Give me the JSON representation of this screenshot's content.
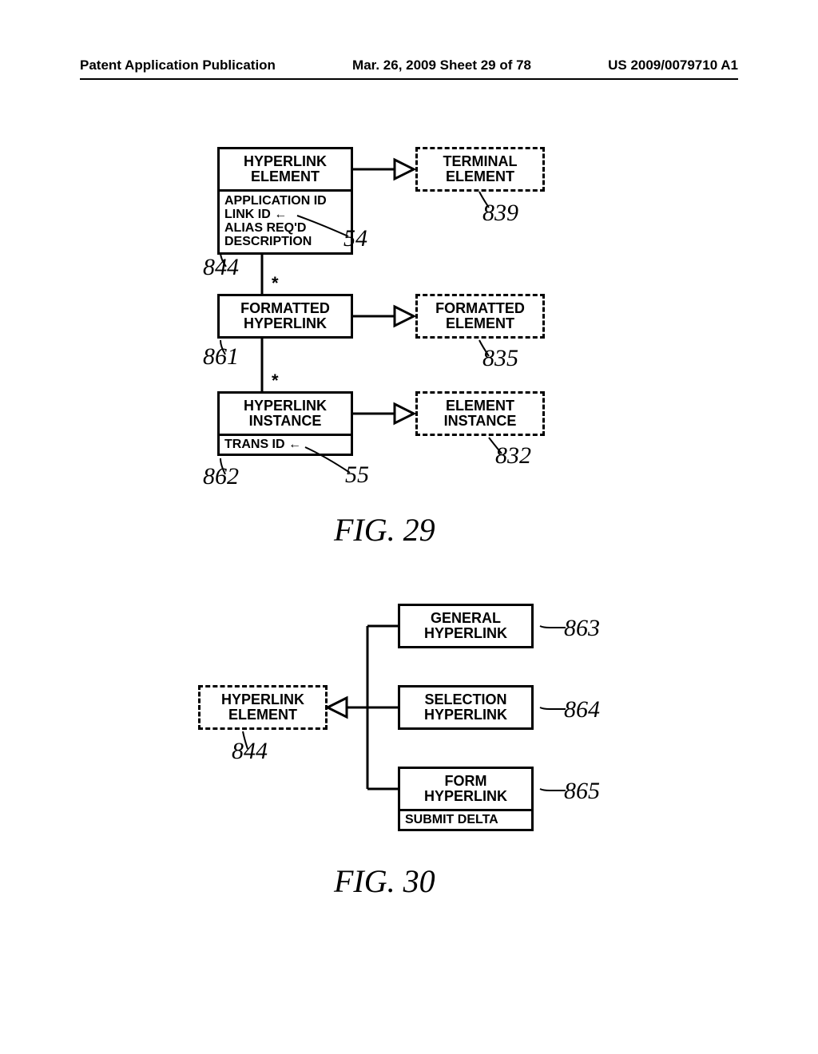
{
  "header": {
    "left": "Patent Application Publication",
    "center": "Mar. 26, 2009  Sheet 29 of 78",
    "right": "US 2009/0079710 A1"
  },
  "fig29": {
    "label": "FIG. 29",
    "hyperlink_element": {
      "title": "HYPERLINK\nELEMENT",
      "attrs": "APPLICATION ID\nLINK ID ←\nALIAS REQ'D\nDESCRIPTION",
      "ref": "844"
    },
    "terminal_element": {
      "title": "TERMINAL\nELEMENT",
      "ref": "839"
    },
    "formatted_hyperlink": {
      "title": "FORMATTED\nHYPERLINK",
      "ref": "861"
    },
    "formatted_element": {
      "title": "FORMATTED\nELEMENT",
      "ref": "835"
    },
    "hyperlink_instance": {
      "title": "HYPERLINK\nINSTANCE",
      "attrs": "TRANS ID ←",
      "ref": "862"
    },
    "element_instance": {
      "title": "ELEMENT\nINSTANCE",
      "ref": "832"
    },
    "ptr54": "54",
    "ptr55": "55"
  },
  "fig30": {
    "label": "FIG. 30",
    "hyperlink_element": {
      "title": "HYPERLINK\nELEMENT",
      "ref": "844"
    },
    "general_hyperlink": {
      "title": "GENERAL\nHYPERLINK",
      "ref": "863"
    },
    "selection_hyperlink": {
      "title": "SELECTION\nHYPERLINK",
      "ref": "864"
    },
    "form_hyperlink": {
      "title": "FORM\nHYPERLINK",
      "attr": "SUBMIT DELTA",
      "ref": "865"
    }
  }
}
